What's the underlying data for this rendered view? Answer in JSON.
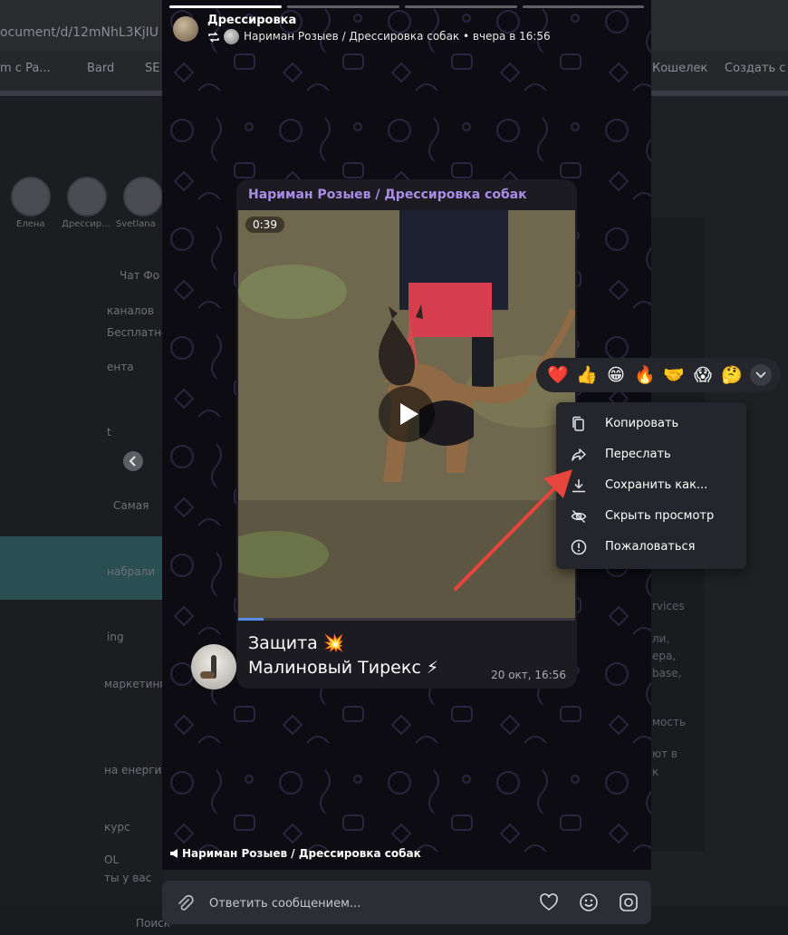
{
  "background": {
    "url_fragment": "ocument/d/12mNhL3KjIU",
    "bookmarks": [
      "m c Pa...",
      "Bard",
      "SE",
      "Кошелек",
      "Создать с"
    ],
    "story_labels": [
      "Елена",
      "Дрессир...",
      "Svetlana"
    ],
    "list_fragments": [
      "Чат Фо",
      "каналов",
      "Бесплатно",
      "ента",
      "t",
      "Самая",
      "набрали",
      "маркетинг",
      "ing",
      "на енерги",
      "курс",
      "OL",
      "ты у вас"
    ],
    "right_fragments": [
      "rvices",
      "ли,",
      "ера,",
      "base,",
      "мость",
      "ют в",
      "к"
    ],
    "taskbar_search": "Поиск"
  },
  "story": {
    "progress_segments": 4,
    "active_segment": 0,
    "author_name": "Дрессировка",
    "meta": "Нариман Розыев / Дрессировка собак • вчера в 16:56",
    "footer": "Нариман Розыев / Дрессировка собак"
  },
  "message": {
    "channel": "Нариман Розыев / Дрессировка собак",
    "video_duration": "0:39",
    "video_progress": 0.075,
    "caption_line1": "Защита 💥",
    "caption_line2": "Малиновый Тирекс ⚡",
    "time": "20 окт, 16:56"
  },
  "reply": {
    "placeholder": "Ответить сообщением..."
  },
  "reactions": [
    "❤️",
    "👍",
    "😁",
    "🔥",
    "🤝",
    "😱",
    "🤔"
  ],
  "context_menu": [
    {
      "label": "Копировать",
      "icon": "copy-icon"
    },
    {
      "label": "Переслать",
      "icon": "forward-icon"
    },
    {
      "label": "Сохранить как...",
      "icon": "download-icon"
    },
    {
      "label": "Скрыть просмотр",
      "icon": "eye-off-icon"
    },
    {
      "label": "Пожаловаться",
      "icon": "report-icon"
    }
  ],
  "colors": {
    "channel_name": "#a98ce6",
    "annotation_arrow": "#e5453a",
    "video_progress_fill": "#5a8dea"
  }
}
